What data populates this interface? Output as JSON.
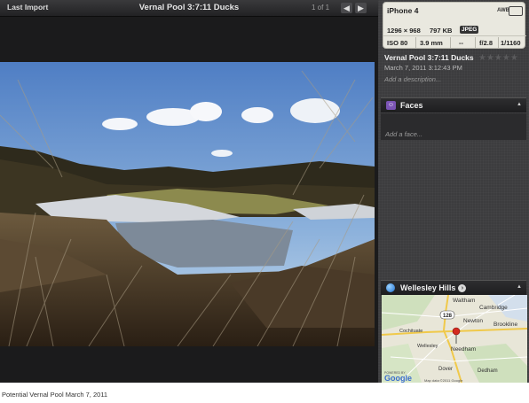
{
  "viewer": {
    "back_label": "Last Import",
    "title": "Vernal Pool 3:7:11 Ducks",
    "counter": "1 of 1",
    "prev_icon": "arrow-left-icon",
    "next_icon": "arrow-right-icon",
    "prev_glyph": "◀",
    "next_glyph": "▶"
  },
  "info": {
    "camera": "iPhone 4",
    "awb": "AWB",
    "resolution": "1296 × 968",
    "filesize": "797 KB",
    "format": "JPEG",
    "iso": "ISO 80",
    "focal": "3.9 mm",
    "exposure_bias": "--",
    "aperture": "f/2.8",
    "shutter": "1/1160"
  },
  "photo_meta": {
    "title": "Vernal Pool 3:7:11 Ducks",
    "date": "March 7, 2011 3:12:43 PM",
    "description_placeholder": "Add a description...",
    "rating_stars": "★★★★★",
    "rating": 0
  },
  "faces": {
    "label": "Faces",
    "add_placeholder": "Add a face...",
    "collapse_glyph": "▲"
  },
  "location": {
    "label": "Wellesley Hills",
    "collapse_glyph": "▲",
    "map_labels": [
      "Waltham",
      "Cambridge",
      "Newton",
      "Brookline",
      "Cochituate",
      "Wellesley",
      "Needham",
      "Dover",
      "Dedham"
    ],
    "route_badge": "128",
    "attribution": "POWERED BY",
    "google": "Google",
    "copyright": "Map data ©2011 Google"
  },
  "caption": "Potential Vernal Pool March 7, 2011",
  "colors": {
    "accent_purple": "#7b54b5",
    "pin_red": "#d42a1f"
  }
}
